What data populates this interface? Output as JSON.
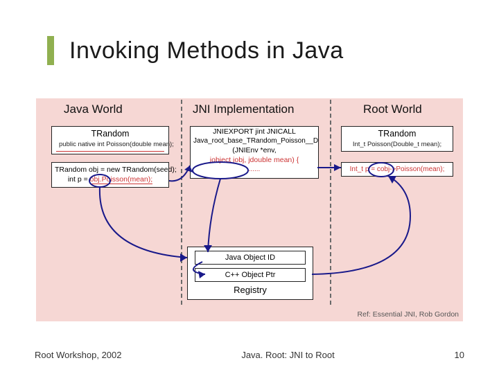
{
  "title": "Invoking Methods in Java",
  "columns": {
    "java": "Java World",
    "jni": "JNI Implementation",
    "root": "Root World"
  },
  "java": {
    "class_name": "TRandom",
    "class_sig": "public native int Poisson(double mean);",
    "ctor_line": "TRandom obj = new TRandom(seed);",
    "call_prefix": "int p = ",
    "call_expr": "obj.Poisson(mean);"
  },
  "jni": {
    "line1": "JNIEXPORT jint JNICALL",
    "line2": "Java_root_base_TRandom_Poisson__D",
    "line3": "(JNIEnv *env,",
    "line4": "jobject jobj, jdouble mean) {",
    "dots": "......"
  },
  "root": {
    "class_name": "TRandom",
    "class_sig": "Int_t Poisson(Double_t mean);",
    "call": "Int_t p = cobj->Poisson(mean);"
  },
  "registry": {
    "cell1": "Java Object ID",
    "cell2": "C++ Object Ptr",
    "label": "Registry"
  },
  "citation": "Ref: Essential JNI, Rob Gordon",
  "footer": {
    "left": "Root Workshop, 2002",
    "center": "Java. Root: JNI to Root",
    "right": "10"
  }
}
